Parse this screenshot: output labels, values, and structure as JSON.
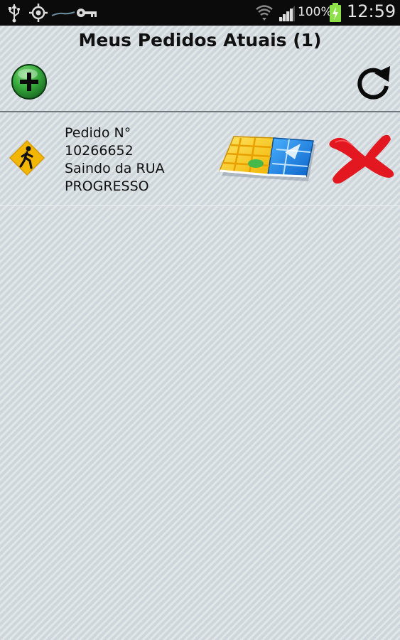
{
  "status_bar": {
    "icons": [
      "usb-icon",
      "gps-icon",
      "activity-wave-icon",
      "key-icon",
      "wifi-icon",
      "signal-icon",
      "battery-charging-icon"
    ],
    "battery": "100%",
    "time": "12:59"
  },
  "header": {
    "title": "Meus Pedidos Atuais (1)",
    "add_icon": "add-circle-icon",
    "refresh_icon": "refresh-icon"
  },
  "orders": [
    {
      "status_icon": "walking-person-icon",
      "line1": "Pedido N°",
      "line2": "10266652",
      "line3": "Saindo da RUA",
      "line4": "PROGRESSO",
      "map_icon": "map-icon",
      "delete_icon": "delete-x-icon"
    }
  ],
  "colors": {
    "status_bar_bg": "#0b0b0b",
    "background": "#d6dde1",
    "add_button": "#2e9b3a",
    "delete_x": "#e3171f",
    "warning_sign": "#f2b705"
  }
}
